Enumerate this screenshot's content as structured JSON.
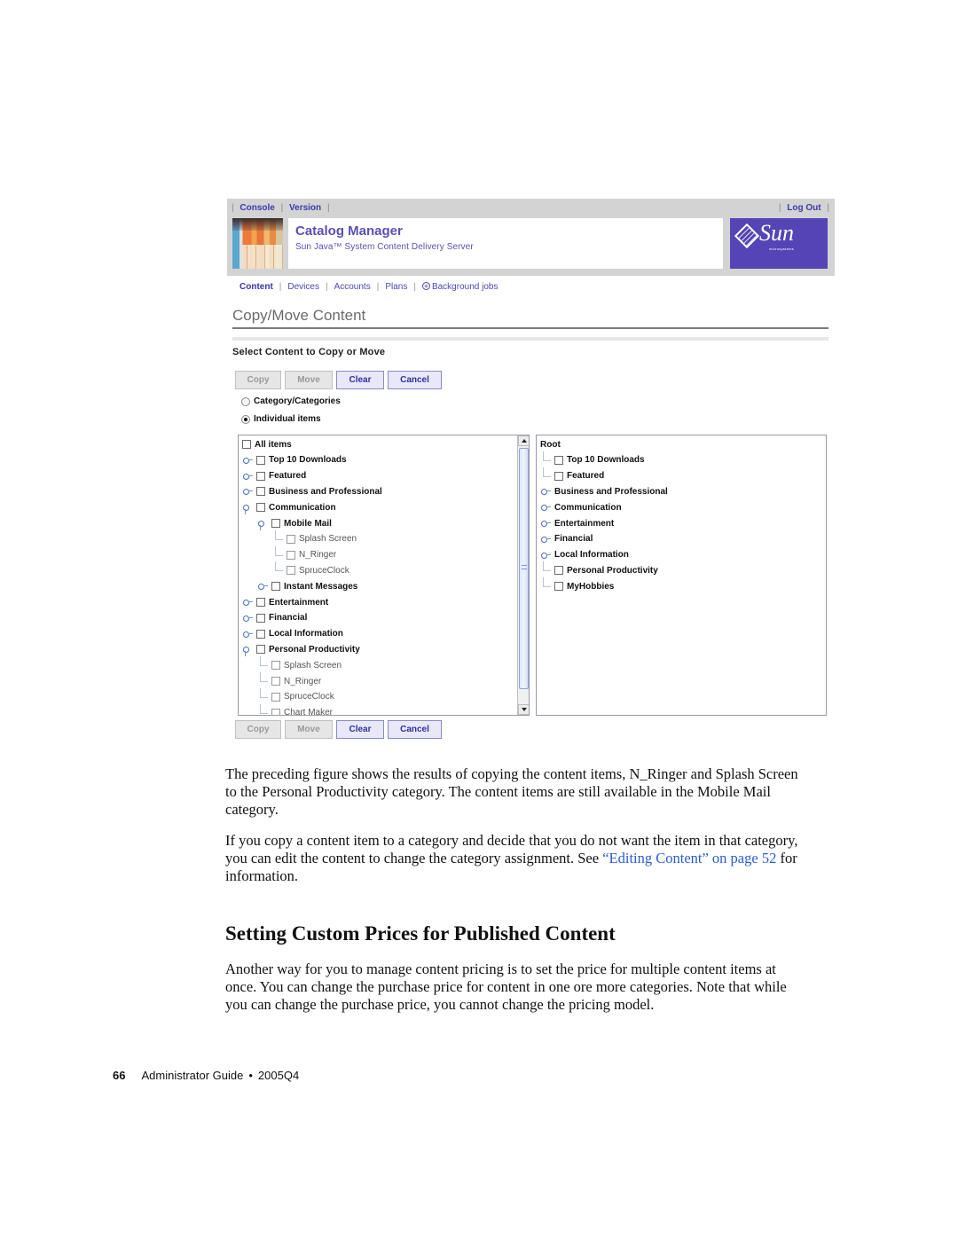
{
  "screenshot": {
    "util_bar": {
      "left_links": [
        "Console",
        "Version"
      ],
      "right_links": [
        "Log Out"
      ]
    },
    "brand": {
      "app_title": "Catalog Manager",
      "app_subtitle": "Sun Java™ System Content Delivery Server",
      "logo_word": "Sun",
      "logo_small": "microsystems"
    },
    "nav_tabs": [
      {
        "label": "Content",
        "active": true
      },
      {
        "label": "Devices",
        "active": false
      },
      {
        "label": "Accounts",
        "active": false
      },
      {
        "label": "Plans",
        "active": false
      },
      {
        "label": "Background jobs",
        "active": false,
        "icon": "background-jobs-icon"
      }
    ],
    "page_title": "Copy/Move Content",
    "section_title": "Select Content to Copy or Move",
    "buttons": {
      "copy": {
        "label": "Copy",
        "enabled": false
      },
      "move": {
        "label": "Move",
        "enabled": false
      },
      "clear": {
        "label": "Clear",
        "enabled": true
      },
      "cancel": {
        "label": "Cancel",
        "enabled": true
      }
    },
    "radio_options": [
      {
        "label": "Category/Categories",
        "checked": false
      },
      {
        "label": "Individual items",
        "checked": true
      }
    ],
    "source_tree": [
      {
        "label": "All items",
        "level": 0,
        "type": "cat",
        "handle": "none",
        "checkbox": true
      },
      {
        "label": "Top 10 Downloads",
        "level": 1,
        "type": "cat",
        "handle": "collapsed",
        "checkbox": true
      },
      {
        "label": "Featured",
        "level": 1,
        "type": "cat",
        "handle": "collapsed",
        "checkbox": true
      },
      {
        "label": "Business and Professional",
        "level": 1,
        "type": "cat",
        "handle": "collapsed",
        "checkbox": true
      },
      {
        "label": "Communication",
        "level": 1,
        "type": "cat",
        "handle": "expanded",
        "checkbox": true
      },
      {
        "label": "Mobile Mail",
        "level": 2,
        "type": "cat",
        "handle": "expanded",
        "checkbox": true
      },
      {
        "label": "Splash Screen",
        "level": 3,
        "type": "leaf",
        "handle": "line",
        "checkbox": true
      },
      {
        "label": "N_Ringer",
        "level": 3,
        "type": "leaf",
        "handle": "line",
        "checkbox": true
      },
      {
        "label": "SpruceClock",
        "level": 3,
        "type": "leaf",
        "handle": "line",
        "checkbox": true
      },
      {
        "label": "Instant Messages",
        "level": 2,
        "type": "cat",
        "handle": "collapsed",
        "checkbox": true
      },
      {
        "label": "Entertainment",
        "level": 1,
        "type": "cat",
        "handle": "collapsed",
        "checkbox": true
      },
      {
        "label": "Financial",
        "level": 1,
        "type": "cat",
        "handle": "collapsed",
        "checkbox": true
      },
      {
        "label": "Local Information",
        "level": 1,
        "type": "cat",
        "handle": "collapsed",
        "checkbox": true
      },
      {
        "label": "Personal Productivity",
        "level": 1,
        "type": "cat",
        "handle": "expanded",
        "checkbox": true
      },
      {
        "label": "Splash Screen",
        "level": 2,
        "type": "leaf",
        "handle": "line",
        "checkbox": true
      },
      {
        "label": "N_Ringer",
        "level": 2,
        "type": "leaf",
        "handle": "line",
        "checkbox": true
      },
      {
        "label": "SpruceClock",
        "level": 2,
        "type": "leaf",
        "handle": "line",
        "checkbox": true
      },
      {
        "label": "Chart Maker",
        "level": 2,
        "type": "leaf",
        "handle": "line",
        "checkbox": true
      }
    ],
    "target_tree": [
      {
        "label": "Root",
        "level": 0,
        "type": "cat",
        "handle": "none",
        "checkbox": false
      },
      {
        "label": "Top 10 Downloads",
        "level": 1,
        "type": "cat",
        "handle": "line",
        "checkbox": true
      },
      {
        "label": "Featured",
        "level": 1,
        "type": "cat",
        "handle": "line",
        "checkbox": true
      },
      {
        "label": "Business and Professional",
        "level": 1,
        "type": "cat",
        "handle": "collapsed",
        "checkbox": false
      },
      {
        "label": "Communication",
        "level": 1,
        "type": "cat",
        "handle": "collapsed",
        "checkbox": false
      },
      {
        "label": "Entertainment",
        "level": 1,
        "type": "cat",
        "handle": "collapsed",
        "checkbox": false
      },
      {
        "label": "Financial",
        "level": 1,
        "type": "cat",
        "handle": "collapsed",
        "checkbox": false
      },
      {
        "label": "Local Information",
        "level": 1,
        "type": "cat",
        "handle": "collapsed",
        "checkbox": false
      },
      {
        "label": "Personal Productivity",
        "level": 1,
        "type": "cat",
        "handle": "line",
        "checkbox": true
      },
      {
        "label": "MyHobbies",
        "level": 1,
        "type": "cat",
        "handle": "line",
        "checkbox": true
      }
    ]
  },
  "document": {
    "para1": "The preceding figure shows the results of copying the content items, N_Ringer and Splash Screen to the Personal Productivity category. The content items are still available in the Mobile Mail category.",
    "para2_before": "If you copy a content item to a category and decide that you do not want the item in that category, you can edit the content to change the category assignment. See ",
    "para2_link": "“Editing Content” on page 52",
    "para2_after": " for information.",
    "heading": "Setting Custom Prices for Published Content",
    "para3": "Another way for you to manage content pricing is to set the price for multiple content items at once. You can change the purchase price for content in one ore more categories. Note that while you can change the purchase price, you cannot change the pricing model.",
    "footer": {
      "page_number": "66",
      "guide_title": "Administrator Guide",
      "bullet": "•",
      "version": "2005Q4"
    }
  }
}
